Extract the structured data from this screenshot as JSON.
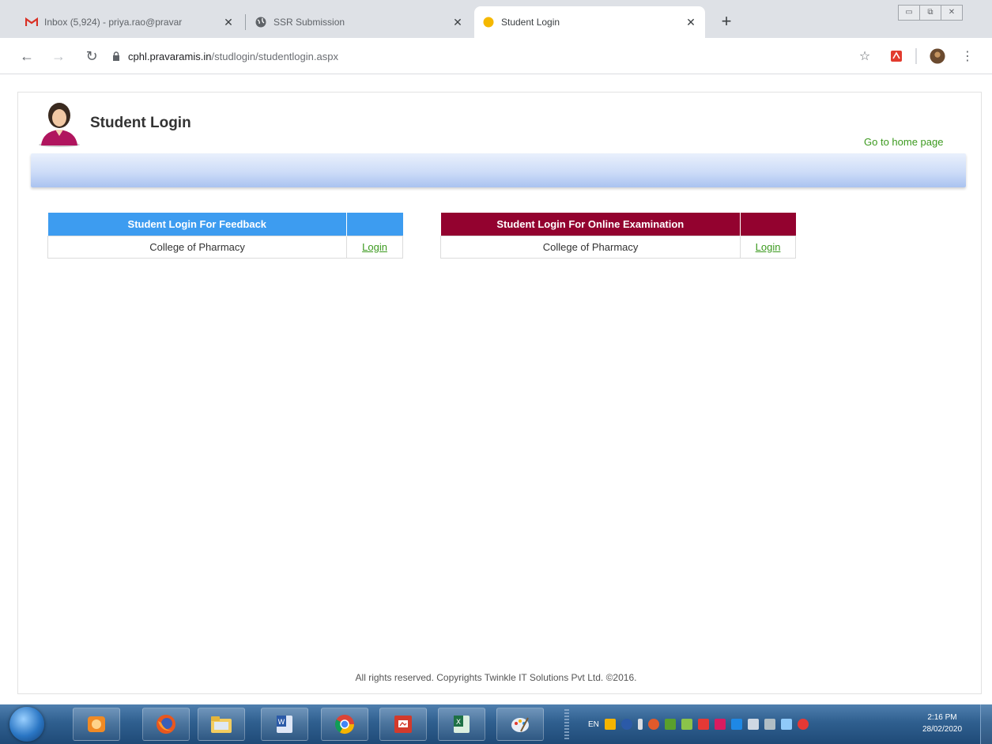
{
  "browser": {
    "tabs": [
      {
        "title": "Inbox (5,924) - priya.rao@pravar",
        "icon": "gmail-icon"
      },
      {
        "title": "SSR Submission",
        "icon": "globe-icon"
      },
      {
        "title": "Student Login",
        "icon": "site-favicon-icon"
      }
    ],
    "url_host": "cphl.pravaramis.in",
    "url_path": "/studlogin/studentlogin.aspx"
  },
  "page": {
    "title": "Student Login",
    "home_link": "Go to home page",
    "feedback_table": {
      "header": "Student Login For Feedback",
      "college": "College of Pharmacy",
      "link": "Login",
      "color": "#3d9cf0"
    },
    "exam_table": {
      "header": "Student Login For Online Examination",
      "college": "College of Pharmacy",
      "link": "Login",
      "color": "#93022f"
    },
    "footer": "All rights reserved. Copyrights Twinkle IT Solutions Pvt Ltd. ©2016."
  },
  "taskbar": {
    "apps": [
      "media-player-icon",
      "firefox-icon",
      "file-explorer-icon",
      "word-icon",
      "chrome-icon",
      "presentation-icon",
      "excel-icon",
      "paint-icon"
    ],
    "tray_language": "EN",
    "clock_time": "2:16 PM",
    "clock_date": "28/02/2020"
  }
}
